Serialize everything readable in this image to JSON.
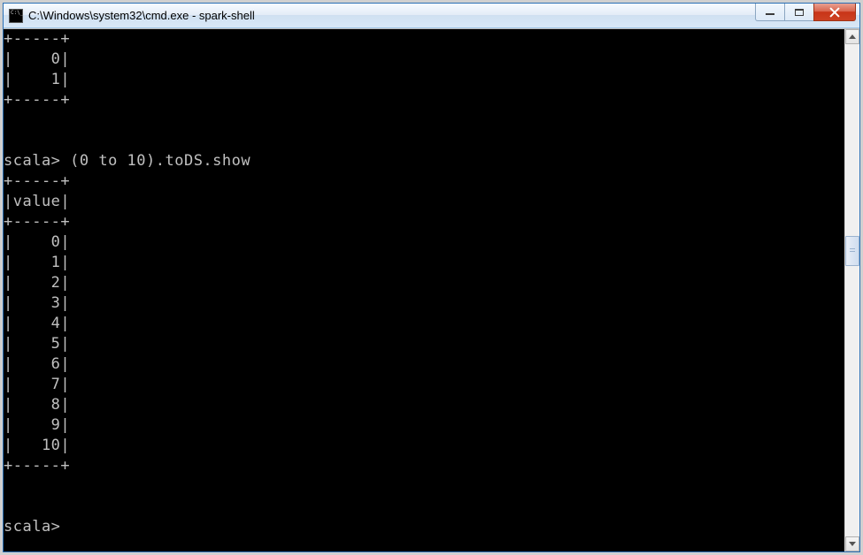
{
  "titlebar": {
    "text": "C:\\Windows\\system32\\cmd.exe - spark-shell"
  },
  "terminal": {
    "lines": [
      "+-----+",
      "|    0|",
      "|    1|",
      "+-----+",
      "",
      "",
      "scala> (0 to 10).toDS.show",
      "+-----+",
      "|value|",
      "+-----+",
      "|    0|",
      "|    1|",
      "|    2|",
      "|    3|",
      "|    4|",
      "|    5|",
      "|    6|",
      "|    7|",
      "|    8|",
      "|    9|",
      "|   10|",
      "+-----+",
      "",
      "",
      "scala>"
    ]
  }
}
